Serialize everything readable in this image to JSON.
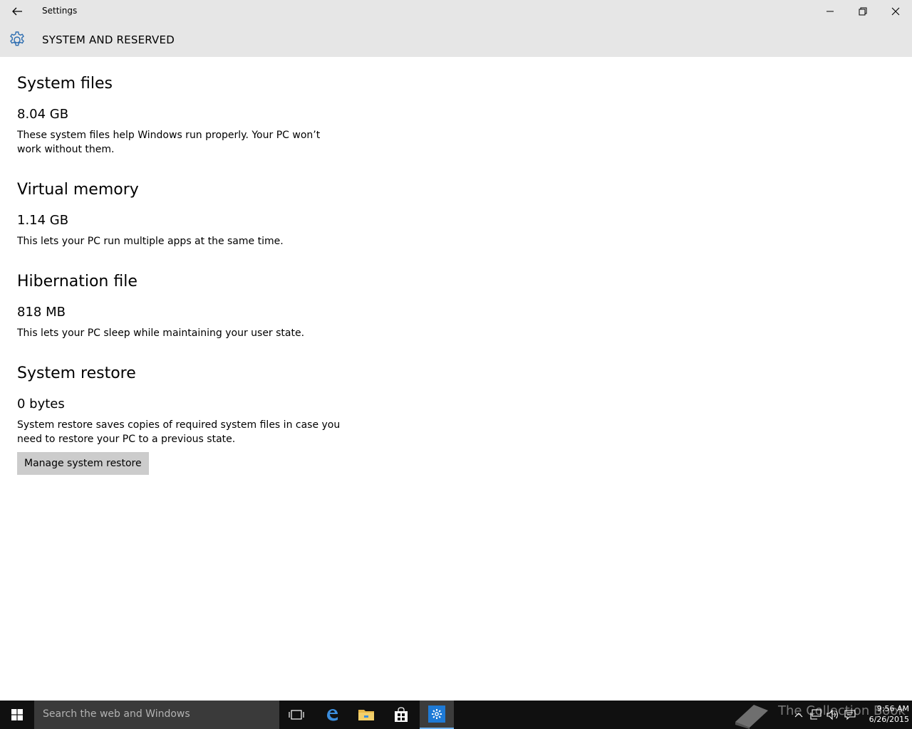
{
  "window": {
    "title": "Settings"
  },
  "header": {
    "title": "SYSTEM AND RESERVED",
    "icon": "gear-icon",
    "accent": "#2b6cb0"
  },
  "sections": [
    {
      "title": "System files",
      "size": "8.04 GB",
      "description": "These system files help Windows run properly. Your PC won’t work without them."
    },
    {
      "title": "Virtual memory",
      "size": "1.14 GB",
      "description": "This lets your PC run multiple apps at the same time."
    },
    {
      "title": "Hibernation file",
      "size": "818 MB",
      "description": "This lets your PC sleep while maintaining your user state."
    },
    {
      "title": "System restore",
      "size": "0 bytes",
      "description": "System restore saves copies of required system files in case you need to restore your PC to a previous state.",
      "button": "Manage system restore"
    }
  ],
  "taskbar": {
    "search_placeholder": "Search the web and Windows",
    "time": "9:56 AM",
    "date": "6/26/2015",
    "watermark": "The Collection Book",
    "active_accent": "#6fb3f0"
  }
}
